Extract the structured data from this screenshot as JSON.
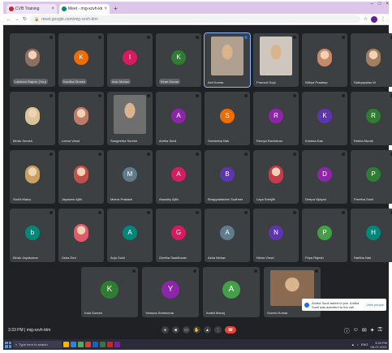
{
  "browser": {
    "tabs": [
      {
        "title": "CVB Training",
        "active": false
      },
      {
        "title": "Meet - mig-xzvh-ktm",
        "active": true
      }
    ],
    "url": "meet.google.com/mig-xzvh-ktm"
  },
  "participants": [
    {
      "name": "Lakshmi Rajesh (You)",
      "type": "photo",
      "color": "#8d6e63",
      "pill": true
    },
    {
      "name": "Kavitha Dinesh",
      "type": "avatar",
      "letter": "K",
      "color": "#ef6c00",
      "pill": true
    },
    {
      "name": "Indu Mohan",
      "type": "avatar",
      "letter": "I",
      "color": "#d81b60",
      "pill": true
    },
    {
      "name": "Kiran Kumar",
      "type": "avatar",
      "letter": "K",
      "color": "#2e7d32",
      "pill": true
    },
    {
      "name": "Anil Kumar",
      "type": "video",
      "color": "#b0a090",
      "highlight": true
    },
    {
      "name": "Pramod Gopi",
      "type": "video",
      "color": "#cfc6bd"
    },
    {
      "name": "Nithya Pradeep",
      "type": "photo",
      "color": "#c48a6a"
    },
    {
      "name": "Sathyapalan M",
      "type": "photo",
      "color": "#a08060"
    },
    {
      "name": "Bindu Suresh",
      "type": "photo",
      "color": "#d9c49a"
    },
    {
      "name": "Leena Vinod",
      "type": "photo",
      "color": "#c07a6a"
    },
    {
      "name": "Sangeetha Suresh",
      "type": "video",
      "color": "#6f6f6f"
    },
    {
      "name": "Anitha Sunil",
      "type": "avatar",
      "letter": "A",
      "color": "#8e24aa"
    },
    {
      "name": "Sreelekha Nair",
      "type": "avatar",
      "letter": "S",
      "color": "#ef6c00"
    },
    {
      "name": "Remya Ravindran",
      "type": "avatar",
      "letter": "R",
      "color": "#8e24aa"
    },
    {
      "name": "Krishna Das",
      "type": "avatar",
      "letter": "K",
      "color": "#5e35b1"
    },
    {
      "name": "Rekha Murali",
      "type": "avatar",
      "letter": "R",
      "color": "#2e7d32"
    },
    {
      "name": "Sruthi Manoj",
      "type": "photo",
      "color": "#c8a060"
    },
    {
      "name": "Jayasree Ajith",
      "type": "photo",
      "color": "#c2504a"
    },
    {
      "name": "Meera Prakash",
      "type": "avatar",
      "letter": "M",
      "color": "#5f7b8c"
    },
    {
      "name": "Aswathy Ajith",
      "type": "avatar",
      "letter": "A",
      "color": "#d81b60"
    },
    {
      "name": "Bhagyalakshmi Sudheer",
      "type": "avatar",
      "letter": "B",
      "color": "#5e35b1"
    },
    {
      "name": "Laya Sreejith",
      "type": "photo",
      "color": "#c73a4a"
    },
    {
      "name": "Deepa Vijayan",
      "type": "avatar",
      "letter": "D",
      "color": "#8e24aa"
    },
    {
      "name": "Preetha Sunil",
      "type": "avatar",
      "letter": "P",
      "color": "#2e7d32"
    },
    {
      "name": "Bindu Jayakumar",
      "type": "avatar",
      "letter": "b",
      "color": "#00897b"
    },
    {
      "name": "Usha Devi",
      "type": "photo",
      "color": "#e05a6a"
    },
    {
      "name": "Anju Sunil",
      "type": "avatar",
      "letter": "A",
      "color": "#00897b"
    },
    {
      "name": "Geetha Sasidharan",
      "type": "avatar",
      "letter": "G",
      "color": "#d81b60"
    },
    {
      "name": "Asha Mohan",
      "type": "avatar",
      "letter": "A",
      "color": "#5f7b8c"
    },
    {
      "name": "Nisha Vinod",
      "type": "avatar",
      "letter": "N",
      "color": "#5e35b1"
    },
    {
      "name": "Priya Rajesh",
      "type": "avatar",
      "letter": "P",
      "color": "#43a047"
    },
    {
      "name": "Haritha Nair",
      "type": "avatar",
      "letter": "H",
      "color": "#00897b"
    },
    {
      "name": "Kala Suresh",
      "type": "avatar",
      "letter": "K",
      "color": "#2e7d32"
    },
    {
      "name": "Yamuna Sreekumar",
      "type": "avatar",
      "letter": "Y",
      "color": "#8e24aa"
    },
    {
      "name": "Ambili Manoj",
      "type": "avatar",
      "letter": "A",
      "color": "#43a047"
    },
    {
      "name": "Suresh Kumar",
      "type": "video",
      "color": "#8a6a50"
    }
  ],
  "notification": {
    "text": "Anitha Sunil asked to join. Anitha Sunil was admitted to the call",
    "action": "View people"
  },
  "controlbar": {
    "meeting_info": "3:33 PM  |  mig-xzvh-ktm"
  },
  "taskbar": {
    "search_placeholder": "Type here to search",
    "time": "3:33 PM",
    "date": "08-07-2021",
    "lang": "ENG"
  }
}
